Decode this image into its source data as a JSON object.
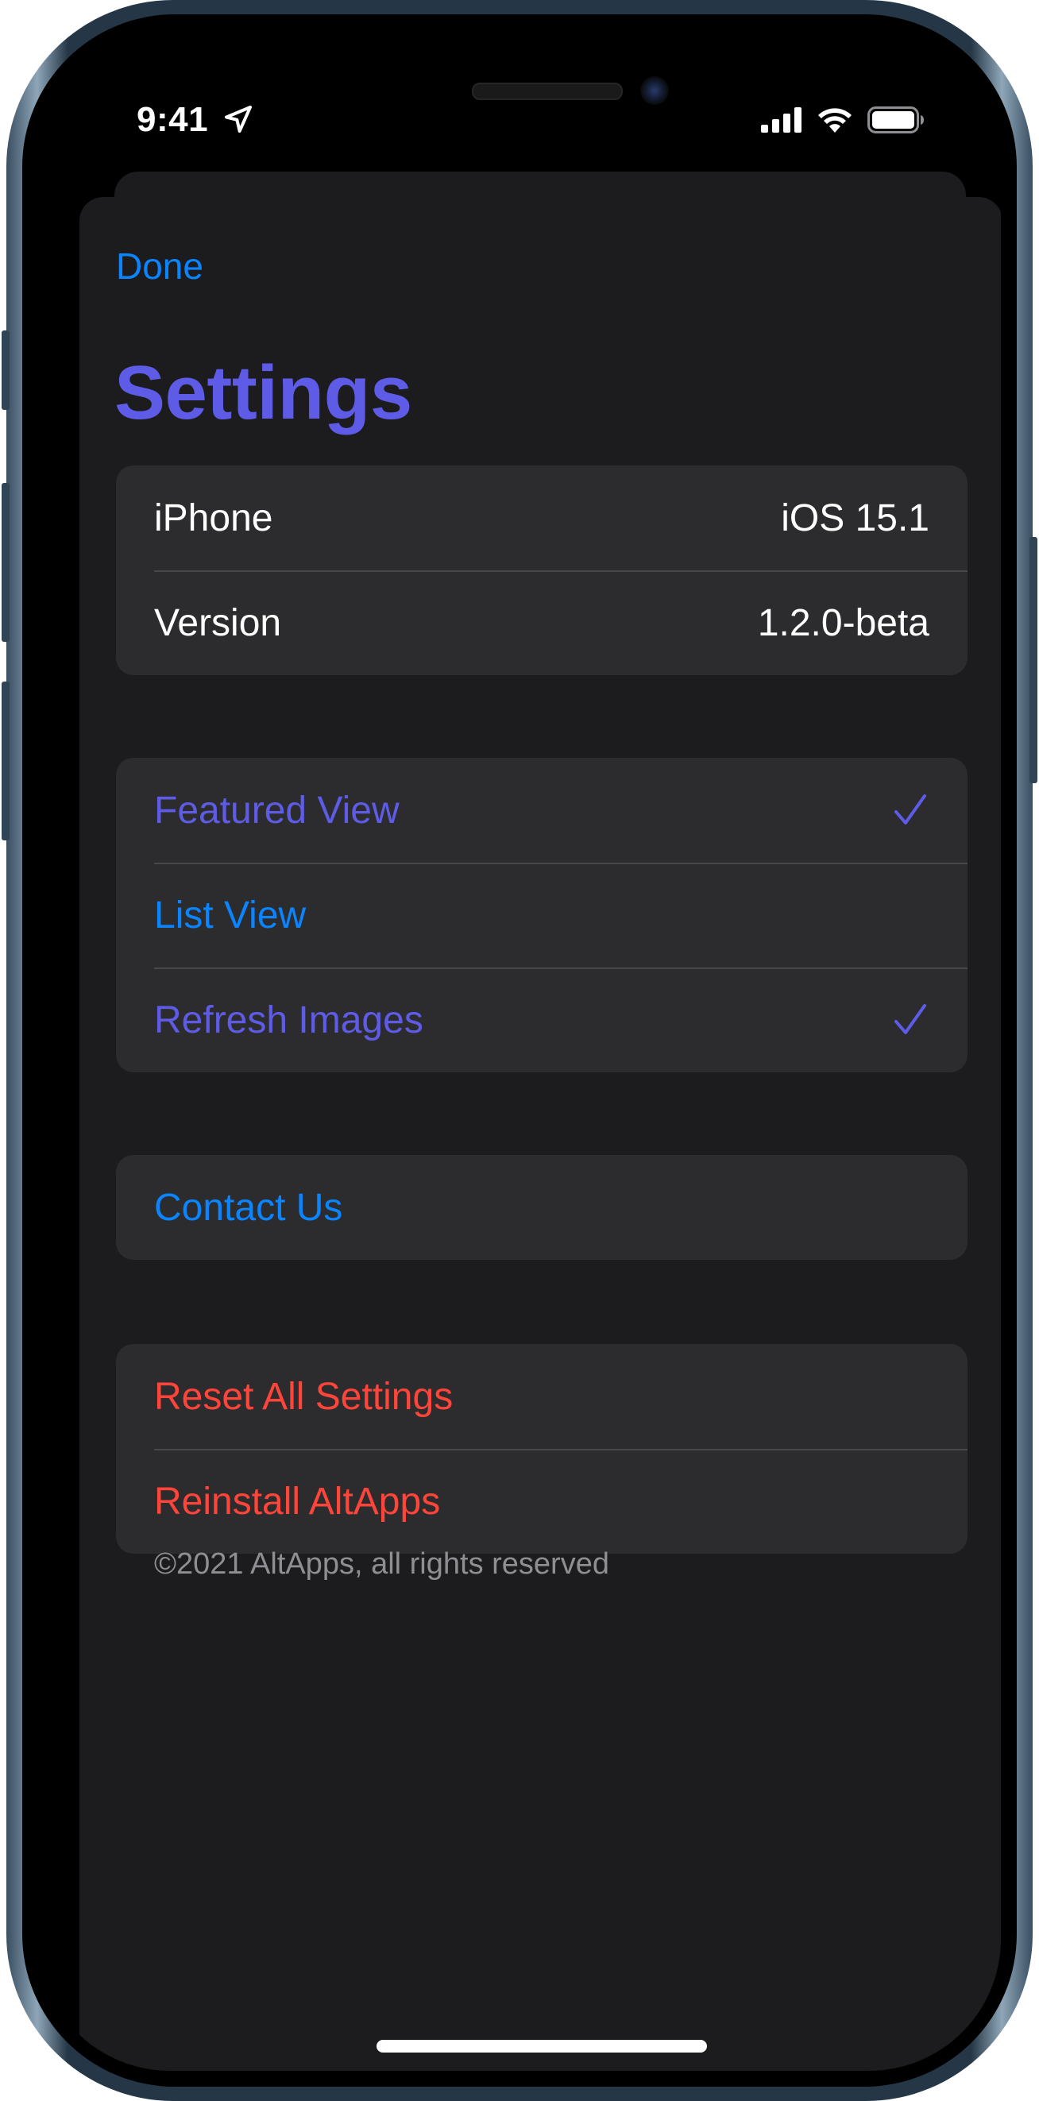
{
  "status_bar": {
    "time": "9:41",
    "icons": [
      "location-arrow-icon",
      "cellular-signal-icon",
      "wifi-icon",
      "battery-icon"
    ]
  },
  "nav": {
    "done_label": "Done"
  },
  "page": {
    "title": "Settings"
  },
  "info_group": {
    "rows": [
      {
        "label": "iPhone",
        "value": "iOS 15.1"
      },
      {
        "label": "Version",
        "value": "1.2.0-beta"
      }
    ]
  },
  "view_group": {
    "rows": [
      {
        "label": "Featured View",
        "checked": true
      },
      {
        "label": "List View",
        "checked": false
      },
      {
        "label": "Refresh Images",
        "checked": true
      }
    ]
  },
  "contact_group": {
    "rows": [
      {
        "label": "Contact Us"
      }
    ]
  },
  "reset_group": {
    "rows": [
      {
        "label": "Reset All Settings"
      },
      {
        "label": "Reinstall AltApps"
      }
    ]
  },
  "footer": {
    "copyright": "©2021 AltApps, all rights reserved"
  },
  "colors": {
    "accent_purple": "#5e5ce6",
    "link_blue": "#0a84ff",
    "destructive_red": "#ff453a",
    "background": "#1c1c1e",
    "cell": "#2c2c2e"
  }
}
